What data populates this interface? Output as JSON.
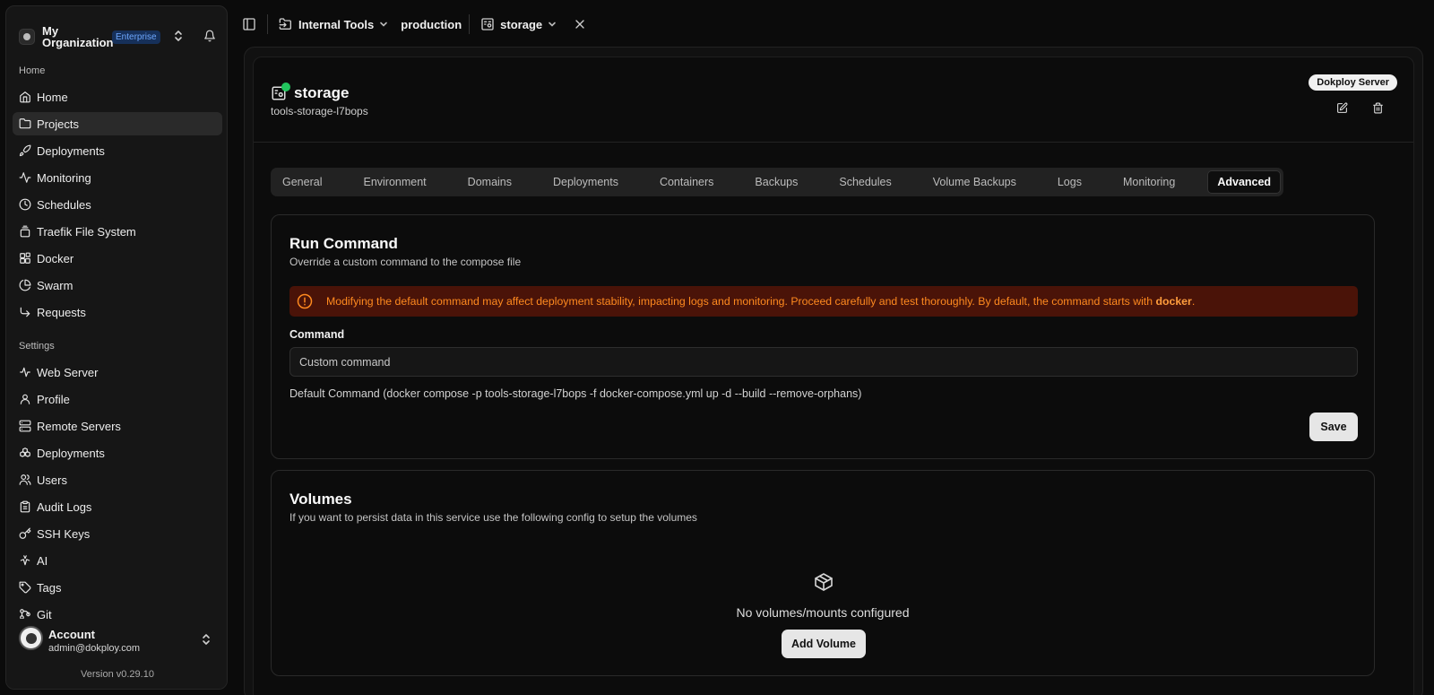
{
  "sidebar": {
    "org_name": "My Organization",
    "org_badge": "Enterprise",
    "section_home": "Home",
    "home_items": [
      {
        "label": "Home",
        "icon": "home-icon"
      },
      {
        "label": "Projects",
        "icon": "folder-icon"
      },
      {
        "label": "Deployments",
        "icon": "rocket-icon"
      },
      {
        "label": "Monitoring",
        "icon": "activity-icon"
      },
      {
        "label": "Schedules",
        "icon": "clock-icon"
      },
      {
        "label": "Traefik File System",
        "icon": "file-stack-icon"
      },
      {
        "label": "Docker",
        "icon": "blocks-icon"
      },
      {
        "label": "Swarm",
        "icon": "pie-icon"
      },
      {
        "label": "Requests",
        "icon": "arrow-icon"
      }
    ],
    "active_item": "Projects",
    "section_settings": "Settings",
    "settings_items": [
      {
        "label": "Web Server",
        "icon": "pulse-icon"
      },
      {
        "label": "Profile",
        "icon": "user-icon"
      },
      {
        "label": "Remote Servers",
        "icon": "server-icon"
      },
      {
        "label": "Deployments",
        "icon": "boxes-icon"
      },
      {
        "label": "Users",
        "icon": "users-icon"
      },
      {
        "label": "Audit Logs",
        "icon": "clipboard-icon"
      },
      {
        "label": "SSH Keys",
        "icon": "key-icon"
      },
      {
        "label": "AI",
        "icon": "bot-icon"
      },
      {
        "label": "Tags",
        "icon": "tags-icon"
      },
      {
        "label": "Git",
        "icon": "git-icon"
      }
    ],
    "account": {
      "name": "Account",
      "email": "admin@dokploy.com",
      "version": "Version v0.29.10"
    }
  },
  "topbar": {
    "project": "Internal Tools",
    "environment": "production",
    "service": "storage"
  },
  "service": {
    "title": "storage",
    "app_name": "tools-storage-l7bops",
    "server_badge": "Dokploy Server",
    "status_color": "#22c55e"
  },
  "tabs": [
    "General",
    "Environment",
    "Domains",
    "Deployments",
    "Containers",
    "Backups",
    "Schedules",
    "Volume Backups",
    "Logs",
    "Monitoring",
    "Advanced"
  ],
  "active_tab": "Advanced",
  "run_command": {
    "title": "Run Command",
    "description": "Override a custom command to the compose file",
    "warning_text": "Modifying the default command may affect deployment stability, impacting logs and monitoring. Proceed carefully and test thoroughly. By default, the command starts with ",
    "warning_bold": "docker",
    "warning_end": ".",
    "field_label": "Command",
    "placeholder": "Custom command",
    "value": "",
    "default_command": "Default Command (docker compose -p tools-storage-l7bops -f docker-compose.yml up -d --build --remove-orphans)",
    "save_label": "Save"
  },
  "volumes": {
    "title": "Volumes",
    "description": "If you want to persist data in this service use the following config to setup the volumes",
    "empty_text": "No volumes/mounts configured",
    "add_label": "Add Volume"
  }
}
